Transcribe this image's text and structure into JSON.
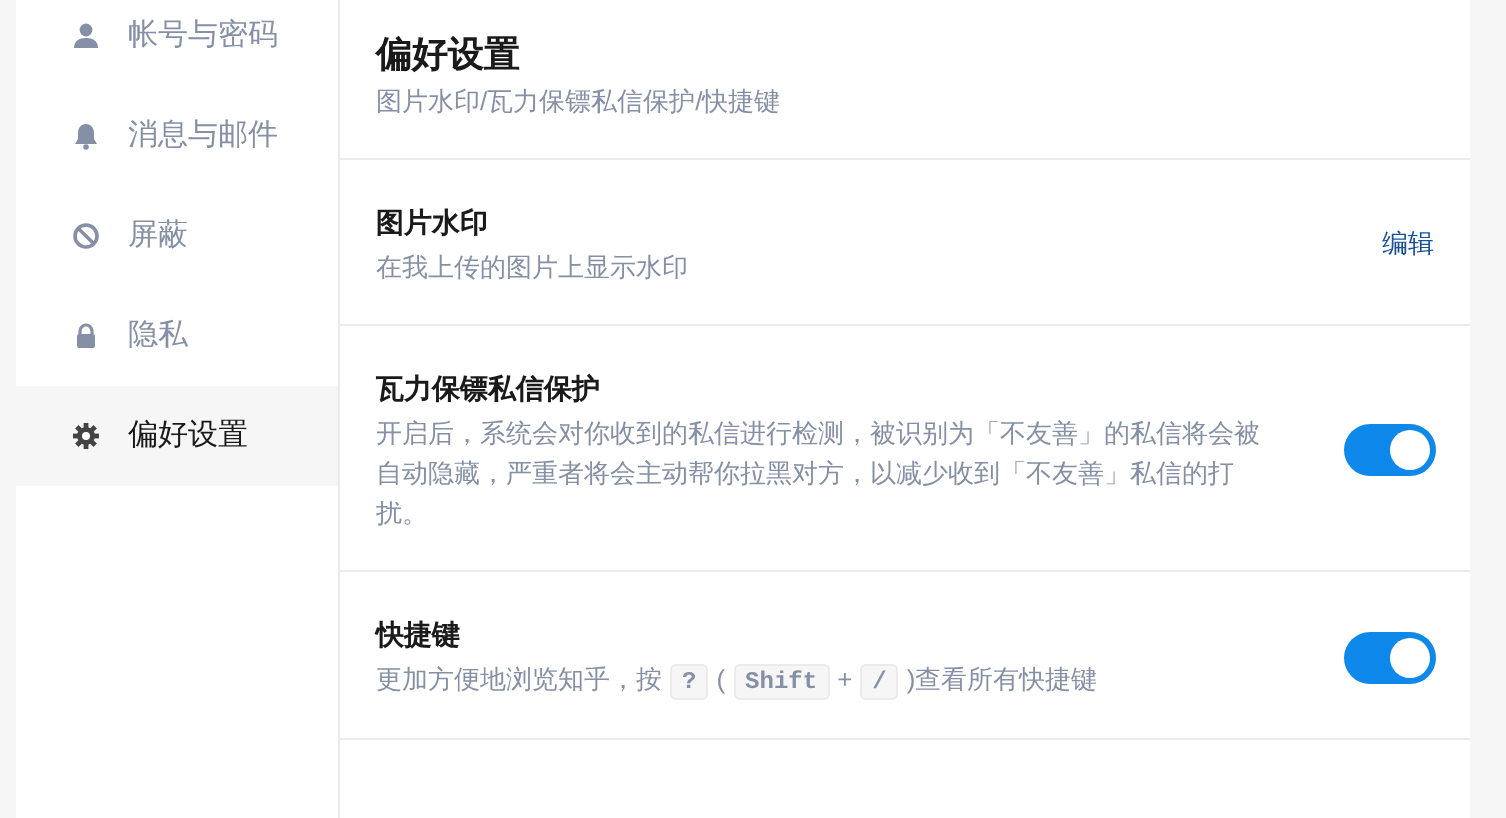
{
  "sidebar": {
    "items": [
      {
        "label": "帐号与密码",
        "kind": "person",
        "selected": false
      },
      {
        "label": "消息与邮件",
        "kind": "bell",
        "selected": false
      },
      {
        "label": "屏蔽",
        "kind": "block",
        "selected": false
      },
      {
        "label": "隐私",
        "kind": "lock",
        "selected": false
      },
      {
        "label": "偏好设置",
        "kind": "gear",
        "selected": true
      }
    ]
  },
  "header": {
    "title": "偏好设置",
    "subtitle": "图片水印/瓦力保镖私信保护/快捷键"
  },
  "sections": [
    {
      "title": "图片水印",
      "description": [
        {
          "kind": "text",
          "text": "在我上传的图片上显示水印"
        }
      ],
      "control": {
        "kind": "link",
        "label": "编辑"
      }
    },
    {
      "title": "瓦力保镖私信保护",
      "description": [
        {
          "kind": "text",
          "text": "开启后，系统会对你收到的私信进行检测，被识别为「不友善」的私信将会被自动隐藏，严重者将会主动帮你拉黑对方，以减少收到「不友善」私信的打扰。"
        }
      ],
      "control": {
        "kind": "toggle",
        "on": true
      }
    },
    {
      "title": "快捷键",
      "description": [
        {
          "kind": "text",
          "text": "更加方便地浏览知乎，按"
        },
        {
          "kind": "key",
          "text": "?"
        },
        {
          "kind": "text",
          "text": "("
        },
        {
          "kind": "key",
          "text": "Shift"
        },
        {
          "kind": "text",
          "text": "+"
        },
        {
          "kind": "key",
          "text": "/"
        },
        {
          "kind": "text",
          "text": ")查看所有快捷键"
        }
      ],
      "control": {
        "kind": "toggle",
        "on": true
      }
    }
  ]
}
